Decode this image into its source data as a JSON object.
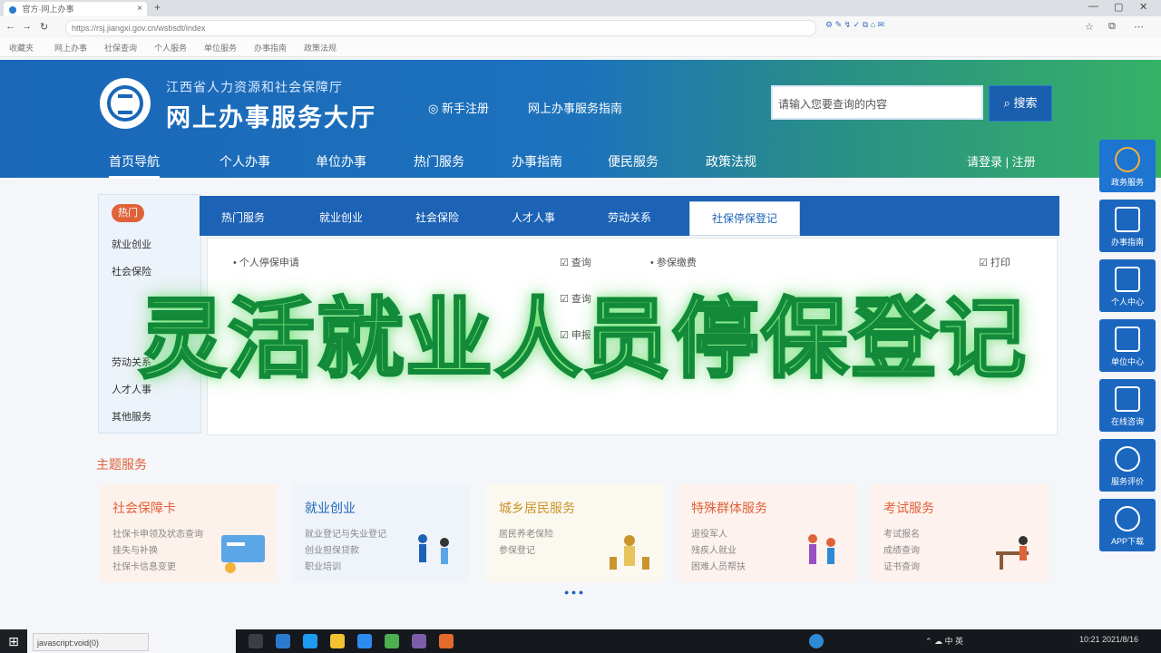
{
  "browser": {
    "tab_title": "官方·网上办事",
    "url": "https://rsj.jiangxi.gov.cn/wsbsdt/index",
    "bookmarks": [
      "收藏夹",
      "网上办事",
      "社保查询",
      "个人服务",
      "单位服务",
      "办事指南",
      "政策法规"
    ],
    "extensions": "⚙ ✎ ↯ ✓ ⧉ ⌂ ✉"
  },
  "site": {
    "org_name": "江西省人力资源和社会保障厅",
    "title": "网上办事服务大厅",
    "link_register": "◎ 新手注册",
    "link_help": "网上办事服务指南",
    "search_placeholder": "请输入您要查询的内容",
    "search_button": "⌕ 搜索"
  },
  "main_nav": [
    "首页导航",
    "个人办事",
    "单位办事",
    "热门服务",
    "办事指南",
    "便民服务",
    "政策法规"
  ],
  "nav_right": "请登录 | 注册",
  "side_panel": {
    "head": "热门",
    "items": [
      "就业创业",
      "社会保险",
      "劳动关系",
      "人才人事",
      "其他服务"
    ]
  },
  "content_tabs": [
    "热门服务",
    "就业创业",
    "社会保险",
    "人才人事",
    "劳动关系",
    "社保停保登记"
  ],
  "content_items": [
    "• 个人停保申请",
    "☑ 查询",
    "• 参保缴费",
    "☑ 打印",
    "☑ 查询",
    "☑ 申报"
  ],
  "section_title": "主题服务",
  "cards": [
    {
      "title": "社会保障卡",
      "lines": [
        "社保卡申领及状态查询",
        "挂失与补换",
        "社保卡信息变更"
      ],
      "bg": "#fdf1ec",
      "color": "#e0623a"
    },
    {
      "title": "就业创业",
      "lines": [
        "就业登记与失业登记",
        "创业担保贷款",
        "职业培训"
      ],
      "bg": "#eef4fa",
      "color": "#1c62b5"
    },
    {
      "title": "城乡居民服务",
      "lines": [
        "居民养老保险",
        "参保登记"
      ],
      "bg": "#fbf8ef",
      "color": "#c9952c"
    },
    {
      "title": "特殊群体服务",
      "lines": [
        "退役军人",
        "残疾人就业",
        "困难人员帮扶"
      ],
      "bg": "#fdf2ee",
      "color": "#e0623a"
    },
    {
      "title": "考试服务",
      "lines": [
        "考试报名",
        "成绩查询",
        "证书查询"
      ],
      "bg": "#fdf2ee",
      "color": "#e0623a"
    }
  ],
  "pager": "● ● ●",
  "right_rail": [
    "政务服务",
    "办事指南",
    "个人中心",
    "单位中心",
    "在线咨询",
    "服务评价",
    "APP下载"
  ],
  "overlay_text": "灵活就业人员停保登记",
  "status_text": "javascript:void(0)",
  "taskbar": {
    "tray_text": "⌃ ☁ 中 英",
    "time": "10:21 2021/8/16"
  }
}
